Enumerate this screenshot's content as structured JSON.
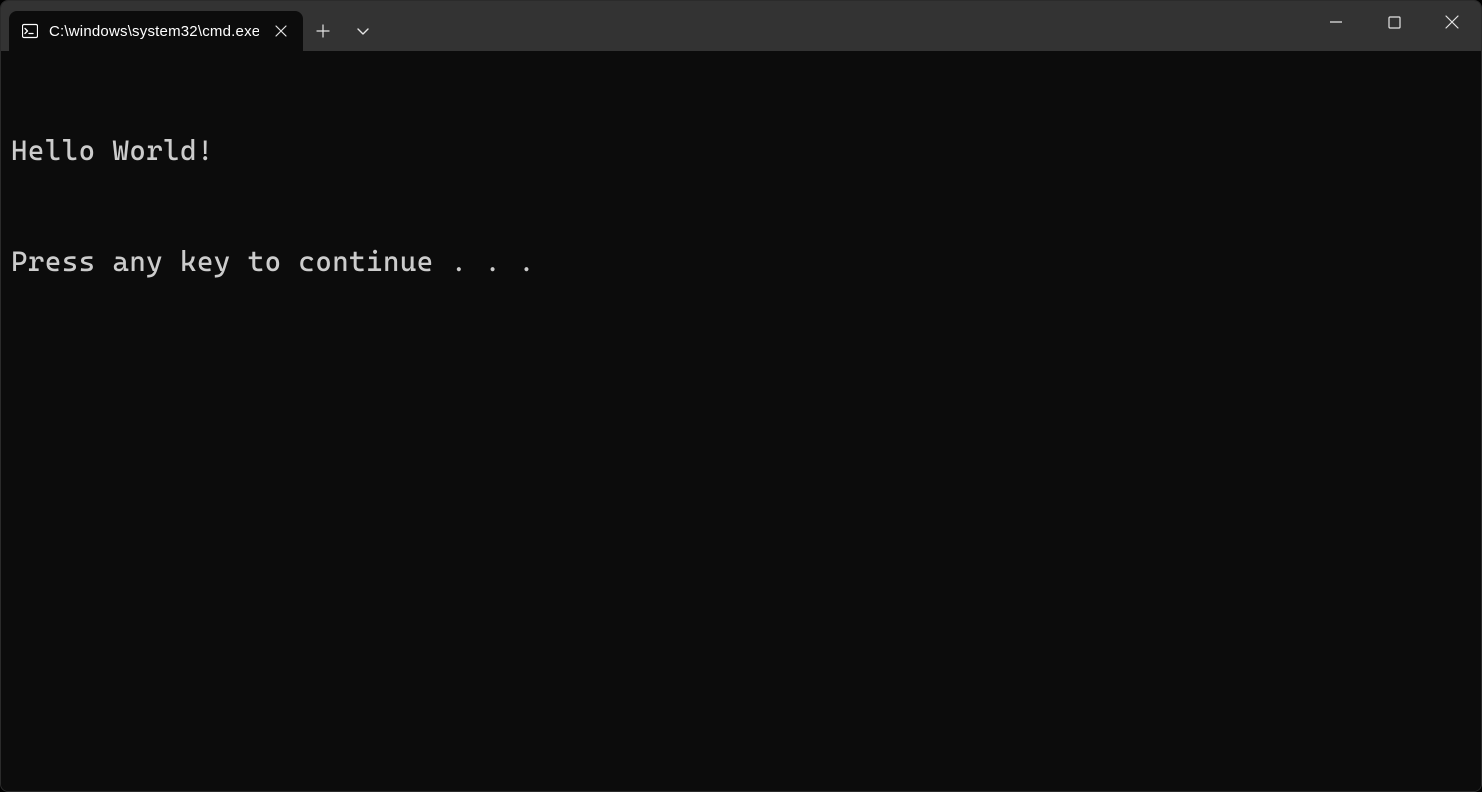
{
  "tab": {
    "title": "C:\\windows\\system32\\cmd.exe",
    "icon": "terminal-icon"
  },
  "titlebar": {
    "new_tab_icon": "plus-icon",
    "dropdown_icon": "chevron-down-icon"
  },
  "window_controls": {
    "minimize_icon": "minimize-icon",
    "maximize_icon": "maximize-icon",
    "close_icon": "close-icon"
  },
  "terminal": {
    "lines": [
      "Hello World!",
      "Press any key to continue . . ."
    ]
  }
}
